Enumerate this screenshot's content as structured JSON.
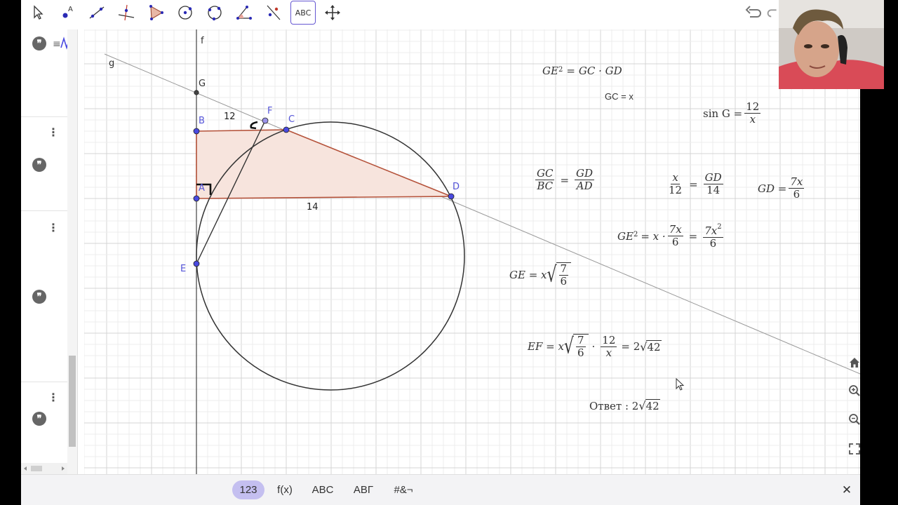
{
  "toolbar": {
    "tools": [
      {
        "name": "move",
        "label": ""
      },
      {
        "name": "point",
        "label": "A"
      },
      {
        "name": "line",
        "label": ""
      },
      {
        "name": "perpendicular-line",
        "label": ""
      },
      {
        "name": "polygon",
        "label": ""
      },
      {
        "name": "circle-center-point",
        "label": ""
      },
      {
        "name": "circle-three-points",
        "label": ""
      },
      {
        "name": "angle",
        "label": ""
      },
      {
        "name": "reflect",
        "label": ""
      },
      {
        "name": "text",
        "label": "ABC"
      },
      {
        "name": "move-graphics-view",
        "label": ""
      }
    ],
    "active_tool": "text"
  },
  "algebra": {
    "top_icon": "function-graph-icon",
    "menu_glyph": "⋮",
    "quote_glyph": "❞"
  },
  "graphics": {
    "axis_labels": {
      "f": "f",
      "g": "g"
    },
    "points": {
      "G": "G",
      "B": "B",
      "F": "F",
      "C": "C",
      "A": "A",
      "D": "D",
      "E": "E"
    },
    "segment_labels": {
      "bc": "12",
      "ad": "14"
    },
    "colors": {
      "polygon_fill": "#f7e4dd",
      "polygon_stroke": "#b5533b",
      "point": "#4a4ae0",
      "grid_major": "#d4d4d4",
      "grid_minor": "#ececec"
    }
  },
  "formulas": {
    "f1": {
      "lhs": "GE",
      "rhs": "GC · GD"
    },
    "f2": "GC = x",
    "f3": {
      "lhs": "sin G =",
      "num": "12",
      "den": "x"
    },
    "f4": {
      "n1": "GC",
      "d1": "BC",
      "n2": "GD",
      "d2": "AD"
    },
    "f5": {
      "n1": "x",
      "d1": "12",
      "n2": "GD",
      "d2": "14"
    },
    "f6": {
      "lhs": "GD =",
      "num": "7x",
      "den": "6"
    },
    "f7": {
      "lhs": "GE",
      "mid": "= x ·",
      "n1": "7x",
      "d1": "6",
      "n2": "7x",
      "d2": "6"
    },
    "f8": {
      "lhs": "GE = x",
      "num": "7",
      "den": "6"
    },
    "f9": {
      "lhs": "EF = x",
      "num": "7",
      "den": "6",
      "n2": "12",
      "d2": "x",
      "res": "= 2",
      "rad": "42"
    },
    "f10": {
      "lhs": "Ответ : 2",
      "rad": "42"
    }
  },
  "keyboard": {
    "tabs": [
      "123",
      "f(x)",
      "ABC",
      "ΑΒΓ",
      "#&¬"
    ],
    "selected": "123",
    "close": "✕"
  },
  "top_right": {
    "undo": "undo-icon",
    "redo": "redo-icon"
  }
}
